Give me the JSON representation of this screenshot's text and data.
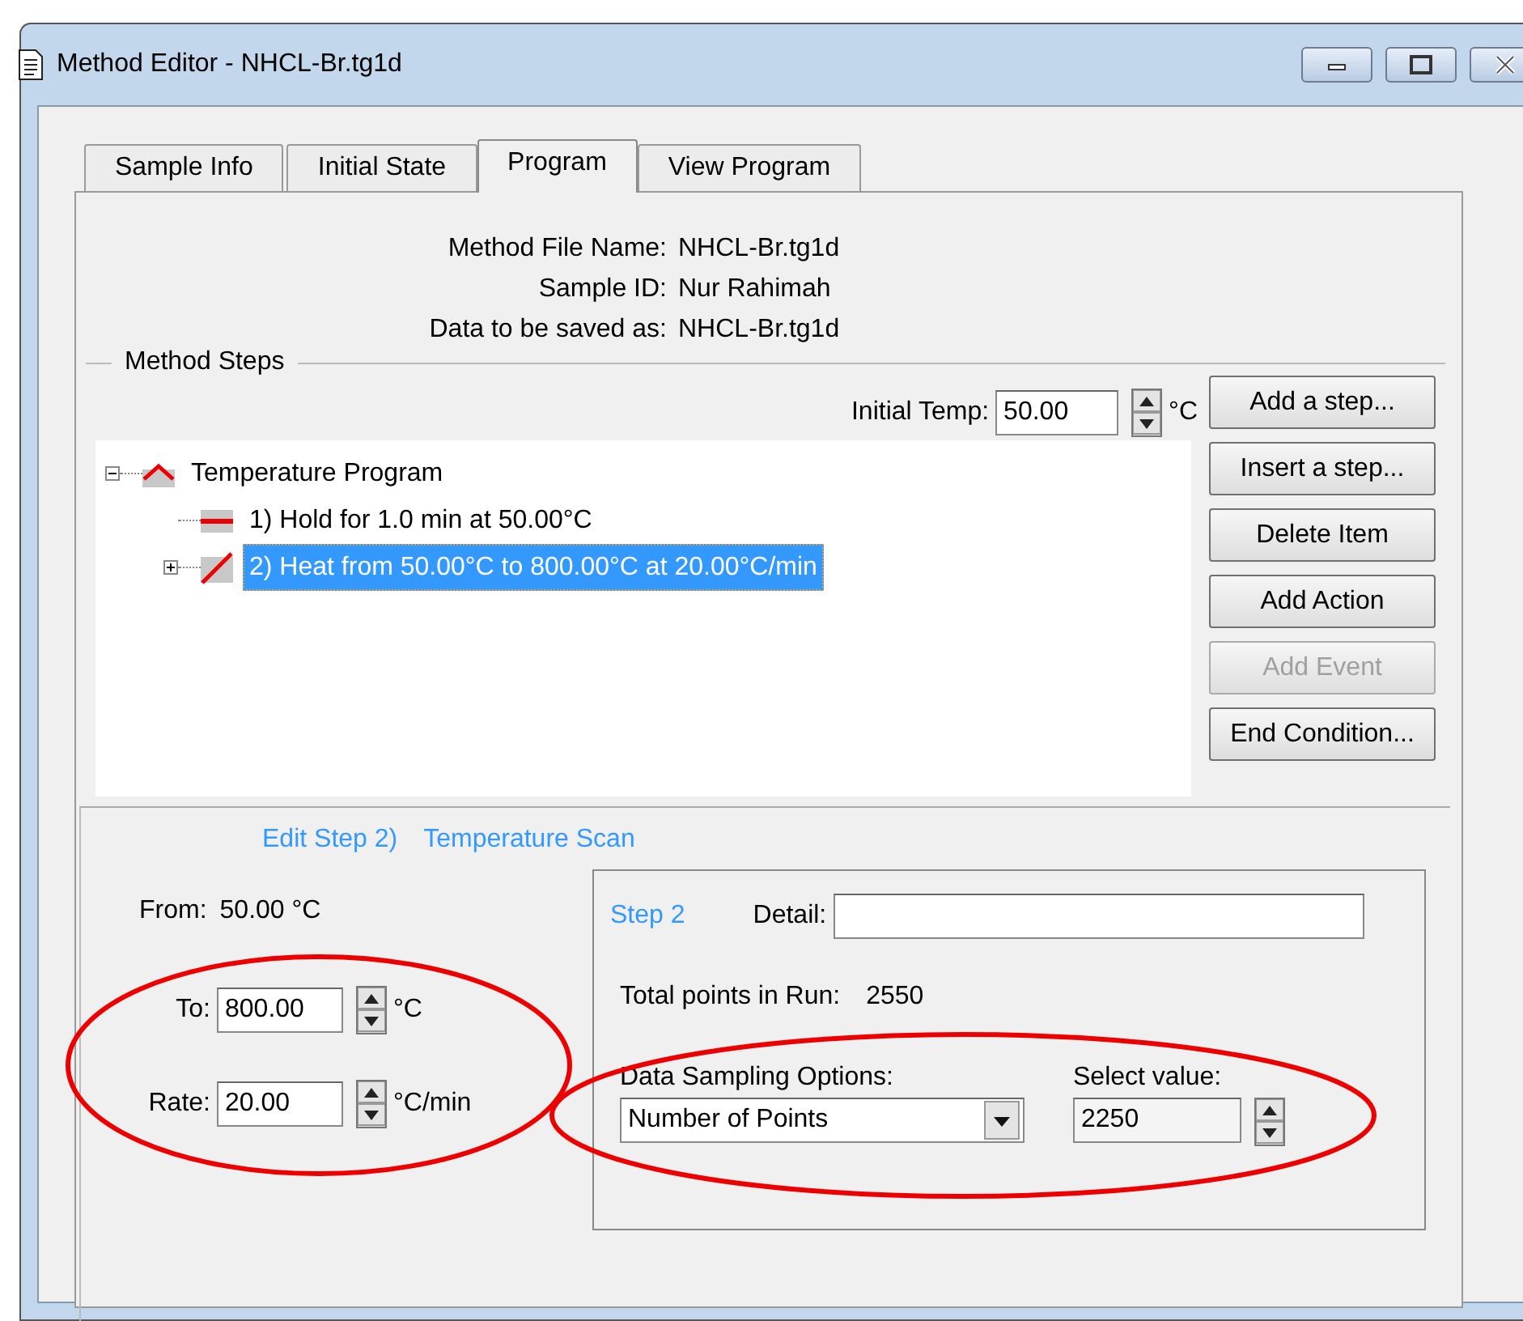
{
  "window": {
    "title": "Method Editor - NHCL-Br.tg1d"
  },
  "tabs": [
    {
      "label": "Sample Info",
      "selected": false
    },
    {
      "label": "Initial State",
      "selected": false
    },
    {
      "label": "Program",
      "selected": true
    },
    {
      "label": "View Program",
      "selected": false
    }
  ],
  "file_info": [
    {
      "label": "Method File Name:",
      "value": "NHCL-Br.tg1d"
    },
    {
      "label": "Sample ID:",
      "value": "Nur Rahimah"
    },
    {
      "label": "Data to be saved as:",
      "value": "NHCL-Br.tg1d"
    }
  ],
  "method_steps": {
    "title": "Method Steps",
    "initial_temp": {
      "label": "Initial Temp:",
      "value": "50.00",
      "unit": "°C"
    },
    "tree": [
      {
        "kind": "program",
        "label": "Temperature Program",
        "expanded": true,
        "selected": false,
        "children": [
          {
            "kind": "hold",
            "label": "1) Hold for 1.0 min at 50.00°C",
            "selected": false
          },
          {
            "kind": "ramp",
            "label": "2) Heat from 50.00°C to 800.00°C at 20.00°C/min",
            "expanded": false,
            "selected": true
          }
        ]
      }
    ],
    "buttons": [
      {
        "label": "Add a step...",
        "disabled": false
      },
      {
        "label": "Insert a step...",
        "disabled": false
      },
      {
        "label": "Delete Item",
        "disabled": false
      },
      {
        "label": "Add Action",
        "disabled": false
      },
      {
        "label": "Add Event",
        "disabled": true
      },
      {
        "label": "End Condition...",
        "disabled": false
      }
    ]
  },
  "edit_step": {
    "title": "Edit Step 2)",
    "subtitle": "Temperature Scan",
    "from_label": "From:",
    "from_value": "50.00 °C",
    "circled": true,
    "fields": [
      {
        "label": "To:",
        "value": "800.00",
        "unit": "°C"
      },
      {
        "label": "Rate:",
        "value": "20.00",
        "unit": "°C/min"
      }
    ]
  },
  "step_group": {
    "title": "Step 2",
    "detail_label": "Detail:",
    "total_label": "Total points in Run:",
    "total_value": "2550",
    "circled": true,
    "sampling_label": "Data Sampling Options:",
    "sampling_value": "Number of Points",
    "select_label": "Select value:",
    "select_value": "2250"
  }
}
